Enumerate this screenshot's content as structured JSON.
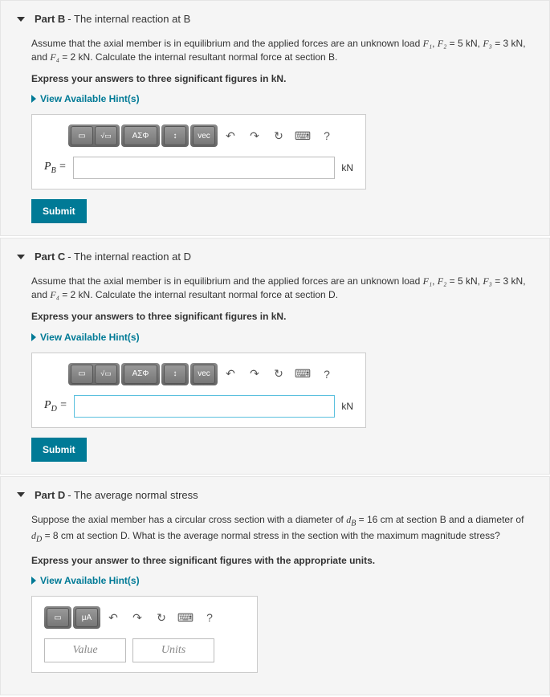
{
  "partB": {
    "title": "Part B",
    "subtitle": " - The internal reaction at B",
    "paragraph_pre": "Assume that the axial member is in equilibrium and the applied forces are an unknown load ",
    "forces": {
      "f1": "F₁",
      "f2_label": "F₂",
      "f2_val": " = 5 kN",
      "f3_label": "F₃",
      "f3_val": " = 3 kN",
      "f4_label": "F₄",
      "f4_val": " = 2 kN"
    },
    "paragraph_post": ". Calculate the internal resultant normal force at section B.",
    "instruction": "Express your answers to three significant figures in kN.",
    "hints": "View Available Hint(s)",
    "toolbar": {
      "sym": "ΑΣΦ",
      "vec": "vec",
      "help": "?"
    },
    "var": "P",
    "sub": "B",
    "eq": " =",
    "unit": "kN",
    "submit": "Submit"
  },
  "partC": {
    "title": "Part C",
    "subtitle": " - The internal reaction at D",
    "paragraph_pre": "Assume that the axial member is in equilibrium and the applied forces are an unknown load ",
    "forces": {
      "f1": "F₁",
      "f2_label": "F₂",
      "f2_val": " = 5 kN",
      "f3_label": "F₃",
      "f3_val": " = 3 kN",
      "f4_label": "F₄",
      "f4_val": " = 2 kN"
    },
    "paragraph_post": ". Calculate the internal resultant normal force at section D.",
    "instruction": "Express your answers to three significant figures in kN.",
    "hints": "View Available Hint(s)",
    "toolbar": {
      "sym": "ΑΣΦ",
      "vec": "vec",
      "help": "?"
    },
    "var": "P",
    "sub": "D",
    "eq": " =",
    "unit": "kN",
    "submit": "Submit"
  },
  "partD": {
    "title": "Part D",
    "subtitle": " - The average normal stress",
    "paragraph_pre": "Suppose the axial member has a circular cross section with a diameter of ",
    "d1_label": "d",
    "d1_sub": "B",
    "d1_val": " = 16 cm",
    "mid": " at section B and a diameter of ",
    "d2_label": "d",
    "d2_sub": "D",
    "d2_val": " = 8 cm",
    "paragraph_post": " at section D. What is the average normal stress in the section with the maximum magnitude stress?",
    "instruction": "Express your answer to three significant figures with the appropriate units.",
    "hints": "View Available Hint(s)",
    "toolbar": {
      "ua": "μA",
      "help": "?"
    },
    "value_ph": "Value",
    "units_ph": "Units"
  }
}
